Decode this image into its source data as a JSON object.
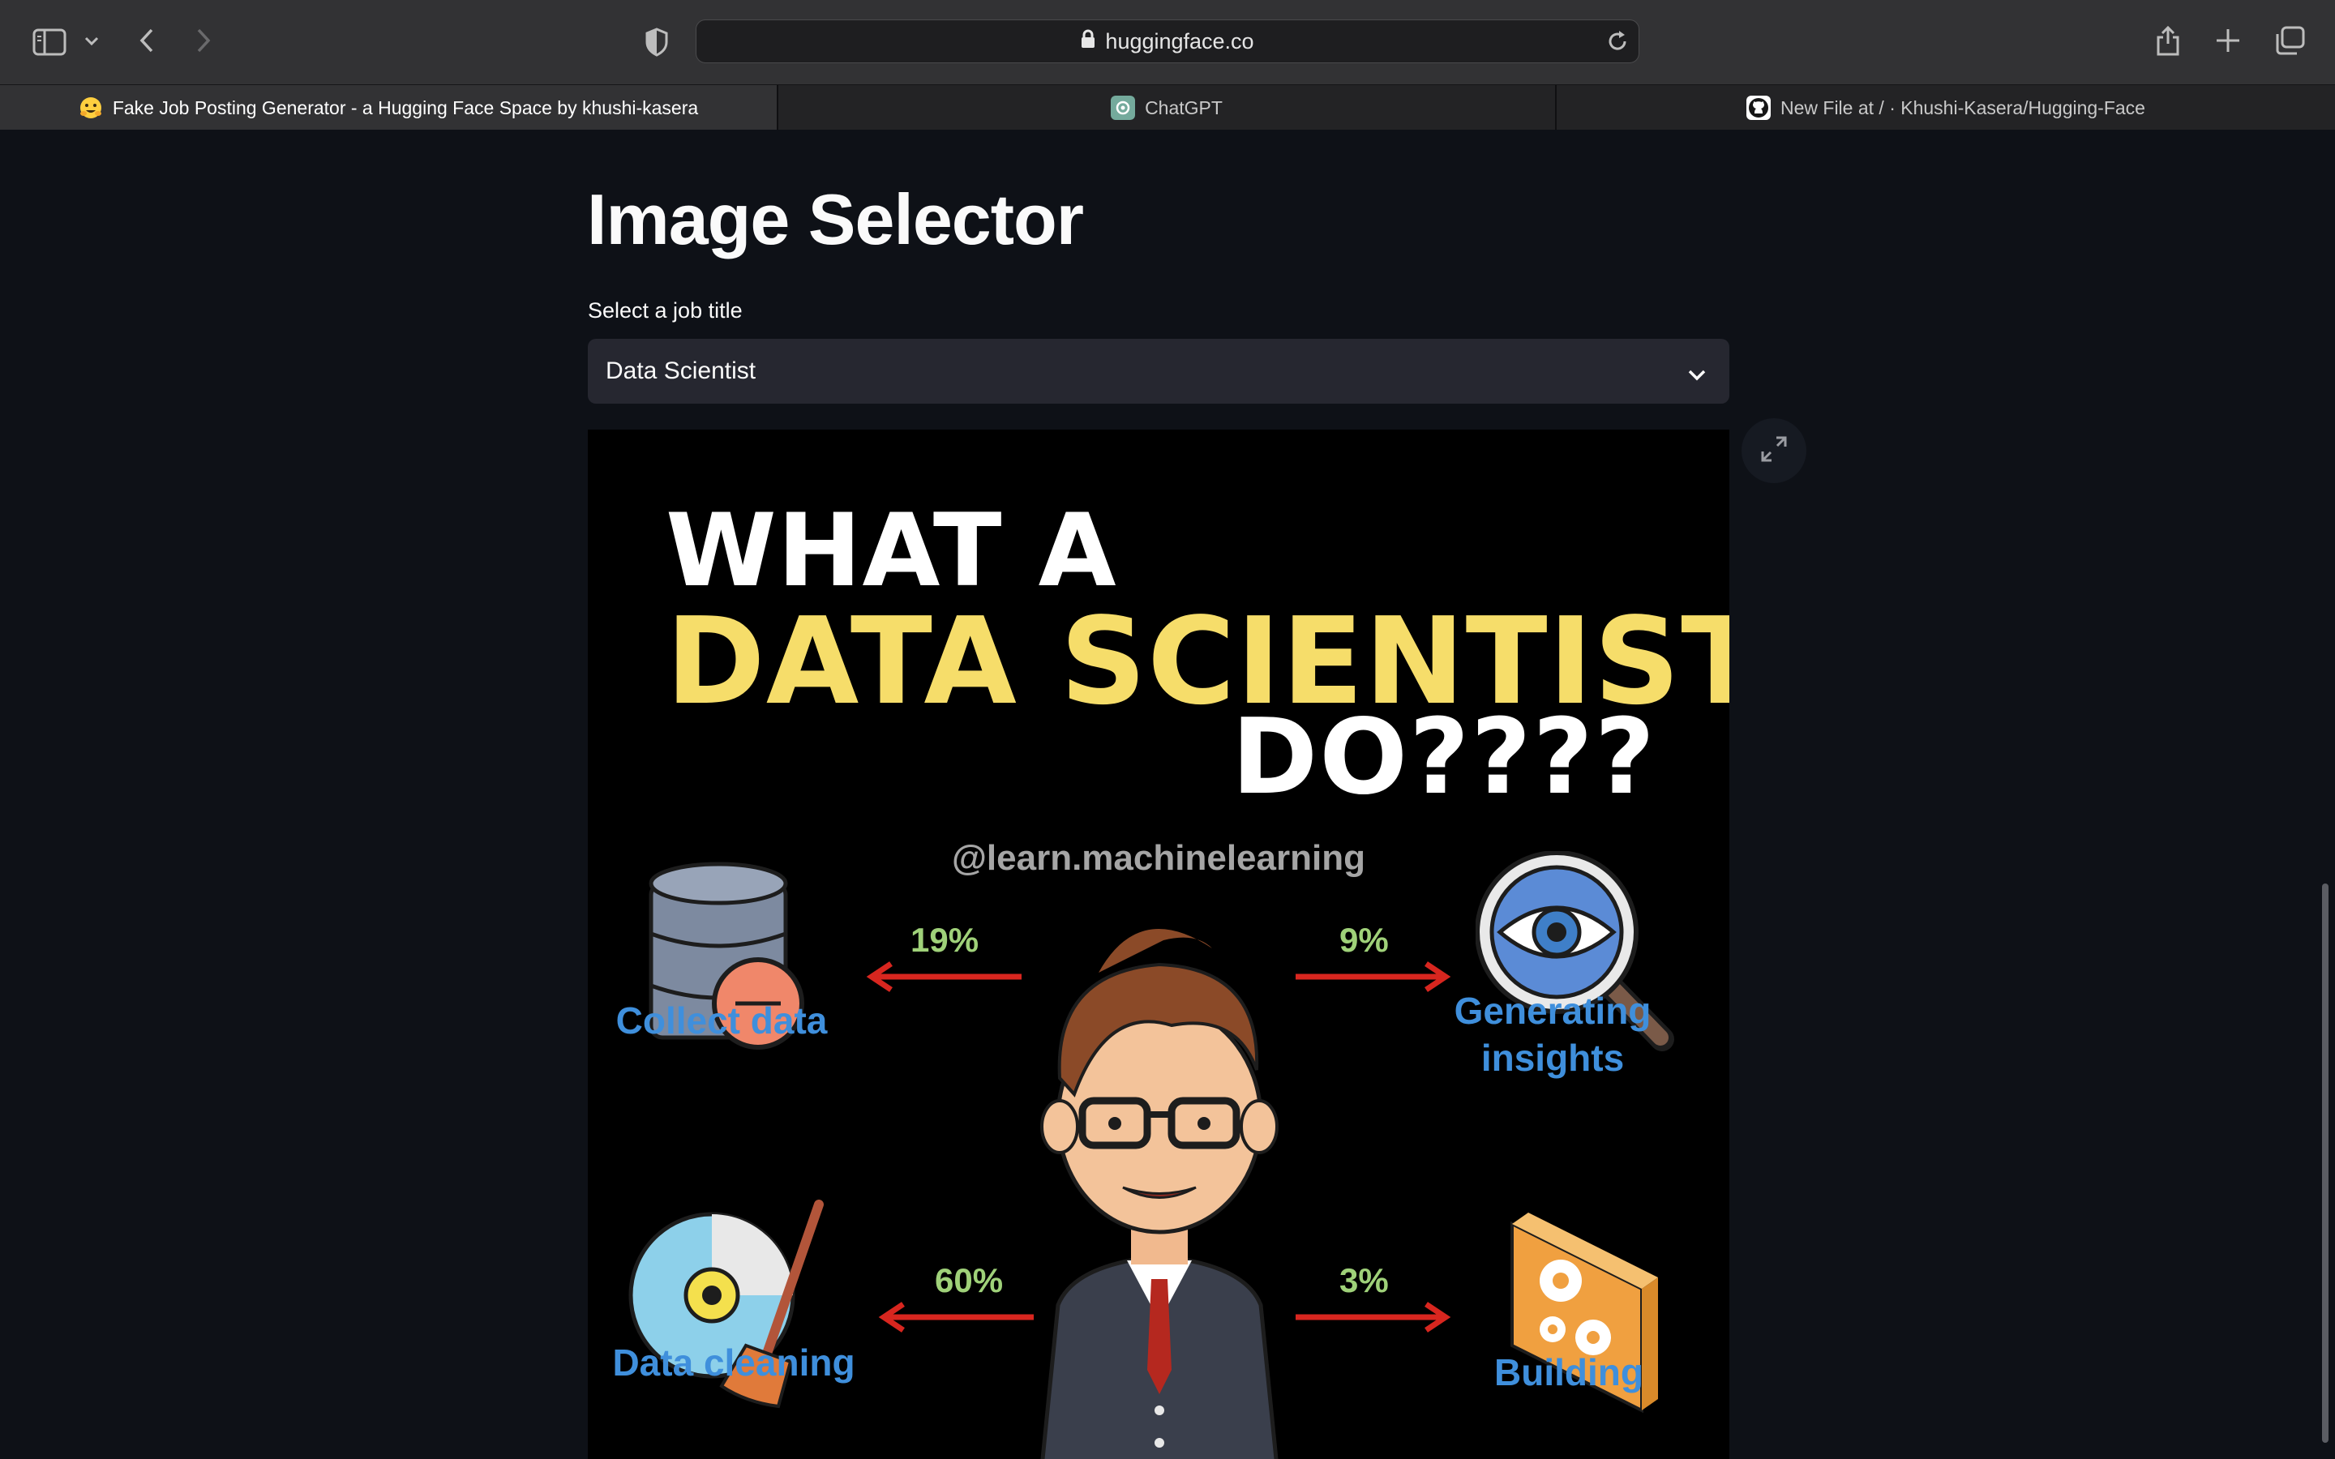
{
  "browser": {
    "url": "huggingface.co",
    "tabs": [
      {
        "label": "Fake Job Posting Generator - a Hugging Face Space by khushi-kasera",
        "active": true,
        "favicon": "hugging-face-emoji"
      },
      {
        "label": "ChatGPT",
        "active": false,
        "favicon": "chatgpt-logo"
      },
      {
        "label": "New File at / · Khushi-Kasera/Hugging-Face",
        "active": false,
        "favicon": "github-logo"
      }
    ]
  },
  "app": {
    "title": "Image Selector",
    "select_label": "Select a job title",
    "select_value": "Data Scientist"
  },
  "infographic": {
    "line1": "WHAT A",
    "line2": "DATA SCIENTIST",
    "line3": "DO????",
    "handle": "@learn.machinelearning",
    "activities": [
      {
        "label": "Collect data",
        "percent": "19%",
        "icon": "database-minus-icon"
      },
      {
        "label": "Generating insights",
        "percent": "9%",
        "icon": "magnifier-eye-icon"
      },
      {
        "label": "Data cleaning",
        "percent": "60%",
        "icon": "disc-broom-icon"
      },
      {
        "label": "Building",
        "percent": "3%",
        "icon": "gears-cube-icon"
      }
    ]
  },
  "colors": {
    "page_bg": "#0e1117",
    "select_bg": "#262730",
    "accent_yellow": "#f6dd6a",
    "percent_green": "#9fd179",
    "label_blue": "#3f8fdc",
    "arrow_red": "#d8261f"
  }
}
